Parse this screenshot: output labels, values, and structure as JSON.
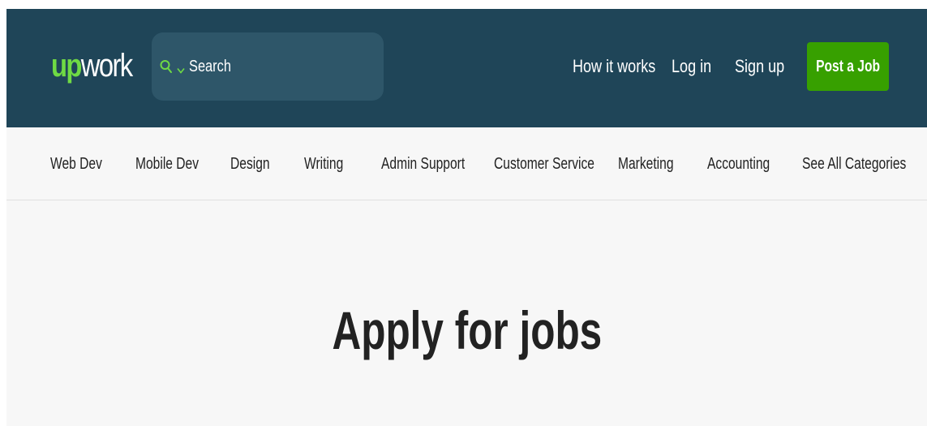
{
  "header": {
    "logo": {
      "part1": "up",
      "part2": "work"
    },
    "search": {
      "label": "Search",
      "icon": "search-icon",
      "dropdown_icon": "chevron-down-icon"
    },
    "nav": {
      "how_it_works": "How it works",
      "log_in": "Log in",
      "sign_up": "Sign up"
    },
    "post_job_label": "Post a Job"
  },
  "categories": [
    "Web Dev",
    "Mobile Dev",
    "Design",
    "Writing",
    "Admin Support",
    "Customer Service",
    "Marketing",
    "Accounting",
    "See All Categories"
  ],
  "hero": {
    "title": "Apply for jobs"
  },
  "colors": {
    "header_bg": "#1f4558",
    "search_bg": "#2e5669",
    "brand_green": "#6fda44",
    "button_green": "#37a000",
    "page_bg": "#f7f7f7"
  }
}
